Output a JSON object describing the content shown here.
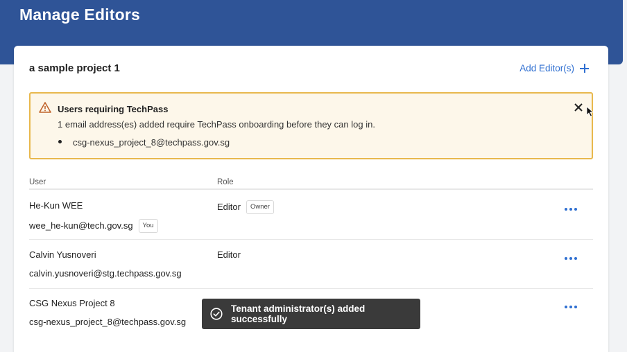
{
  "header": {
    "title": "Manage Editors"
  },
  "project": {
    "name": "a sample project 1",
    "add_editor_label": "Add Editor(s)"
  },
  "alert": {
    "title": "Users requiring TechPass",
    "description": "1 email address(es) added require TechPass onboarding before they can log in.",
    "emails": [
      "csg-nexus_project_8@techpass.gov.sg"
    ],
    "close_glyph": "✕",
    "icon": "warning-icon"
  },
  "table": {
    "columns": [
      "User",
      "Role"
    ],
    "rows": [
      {
        "name": "He-Kun WEE",
        "email": "wee_he-kun@tech.gov.sg",
        "email_badge": "You",
        "role": "Editor",
        "role_badge": "Owner"
      },
      {
        "name": "Calvin Yusnoveri",
        "email": "calvin.yusnoveri@stg.techpass.gov.sg",
        "role": "Editor"
      },
      {
        "name": "CSG Nexus Project 8",
        "email": "csg-nexus_project_8@techpass.gov.sg",
        "role": ""
      }
    ]
  },
  "toast": {
    "message": "Tenant administrator(s) added successfully",
    "icon": "check-circle-icon"
  },
  "colors": {
    "header": "#2f5497",
    "accent": "#2f6fd1",
    "alert_border": "#e8b84d",
    "alert_bg": "#fdf7ea",
    "toast_bg": "#3a3a3a"
  }
}
